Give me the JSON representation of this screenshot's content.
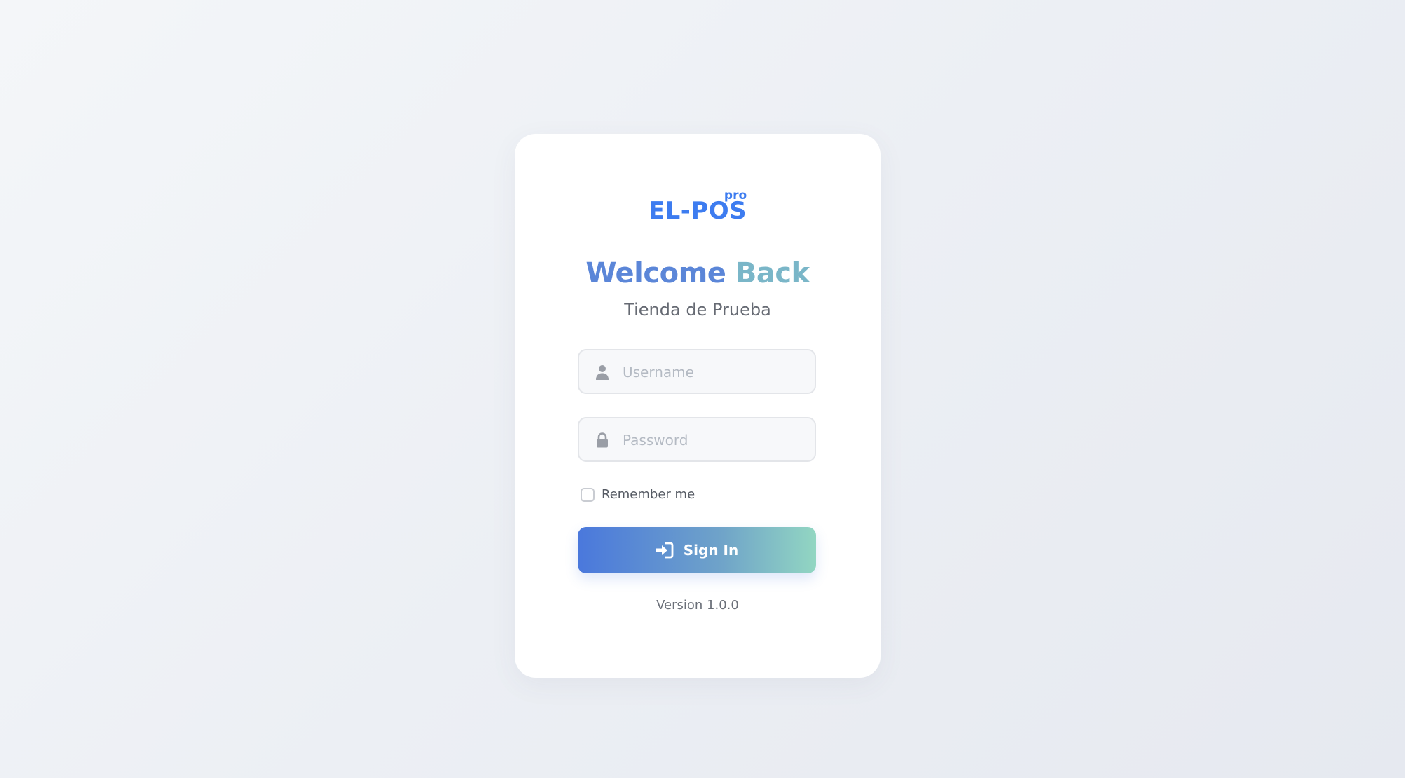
{
  "logo": {
    "main": "EL-POS",
    "superscript": "pro"
  },
  "heading": {
    "part1": "Welcome",
    "part2": "Back"
  },
  "store_name": "Tienda de Prueba",
  "form": {
    "username_placeholder": "Username",
    "username_value": "",
    "password_placeholder": "Password",
    "password_value": "",
    "remember_label": "Remember me",
    "remember_checked": false,
    "submit_label": "Sign In"
  },
  "version": "Version 1.0.0",
  "icons": {
    "username": "user-icon",
    "password": "lock-icon",
    "submit": "sign-in-icon"
  },
  "colors": {
    "brand": "#3d7cf0",
    "heading_start": "#5b86d8",
    "heading_end": "#7ab6c8",
    "button_gradient_start": "#4a78dc",
    "button_gradient_end": "#92d6c2"
  }
}
